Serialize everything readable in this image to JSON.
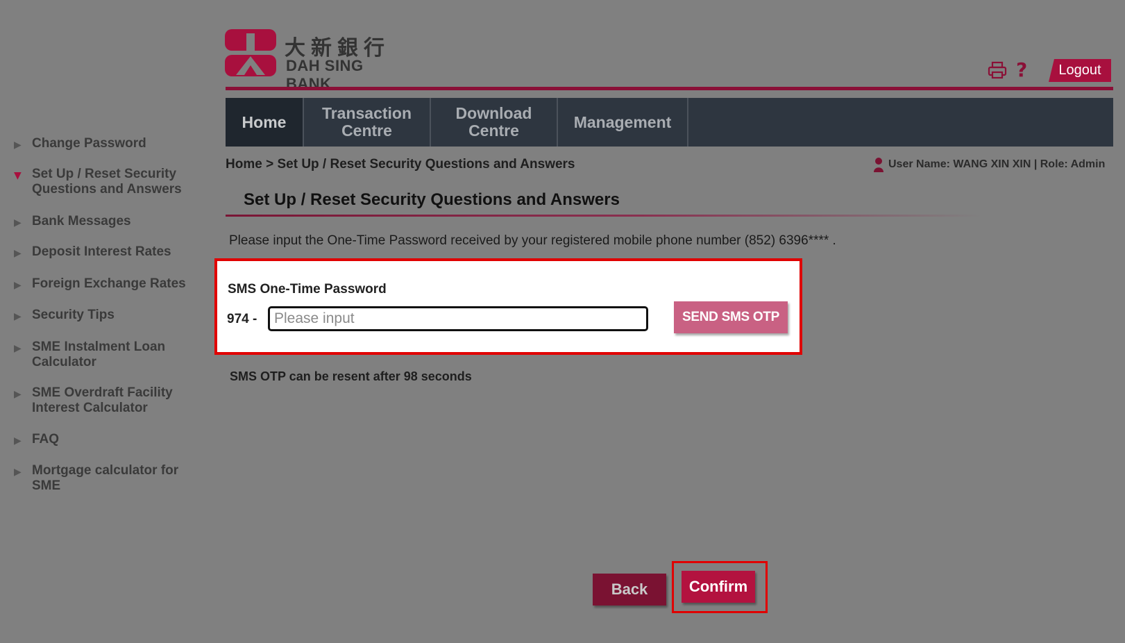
{
  "brand": {
    "name_cn": "大新銀行",
    "name_en": "DAH SING BANK",
    "color": "#a8103e"
  },
  "header": {
    "print_icon": "printer-icon",
    "help_label": "?",
    "logout_label": "Logout"
  },
  "nav": {
    "items": [
      {
        "label": "Home",
        "active": true
      },
      {
        "label": "Transaction Centre",
        "active": false
      },
      {
        "label": "Download Centre",
        "active": false
      },
      {
        "label": "Management",
        "active": false
      }
    ]
  },
  "breadcrumb": {
    "home": "Home",
    "separator": ">",
    "current": "Set Up / Reset Security Questions and Answers"
  },
  "user_info": "User Name: WANG XIN XIN | Role: Admin",
  "page_title": "Set Up / Reset Security Questions and Answers",
  "instruction": "Please input the One-Time Password received by your registered mobile phone number (852) 6396**** .",
  "otp": {
    "label": "SMS One-Time Password",
    "prefix": "974 -",
    "placeholder": "Please input",
    "value": "",
    "send_button": "SEND SMS OTP"
  },
  "resend_note": "SMS OTP can be resent after 98 seconds",
  "sidebar": {
    "items": [
      {
        "label": "Change Password",
        "active": false
      },
      {
        "label": "Set Up / Reset Security Questions and Answers",
        "active": true
      },
      {
        "label": "Bank Messages",
        "active": false
      },
      {
        "label": "Deposit Interest Rates",
        "active": false
      },
      {
        "label": "Foreign Exchange Rates",
        "active": false
      },
      {
        "label": "Security Tips",
        "active": false
      },
      {
        "label": "SME Instalment Loan Calculator",
        "active": false
      },
      {
        "label": "SME Overdraft Facility Interest Calculator",
        "active": false
      },
      {
        "label": "FAQ",
        "active": false
      },
      {
        "label": "Mortgage calculator for SME",
        "active": false
      }
    ]
  },
  "actions": {
    "back_label": "Back",
    "confirm_label": "Confirm"
  }
}
